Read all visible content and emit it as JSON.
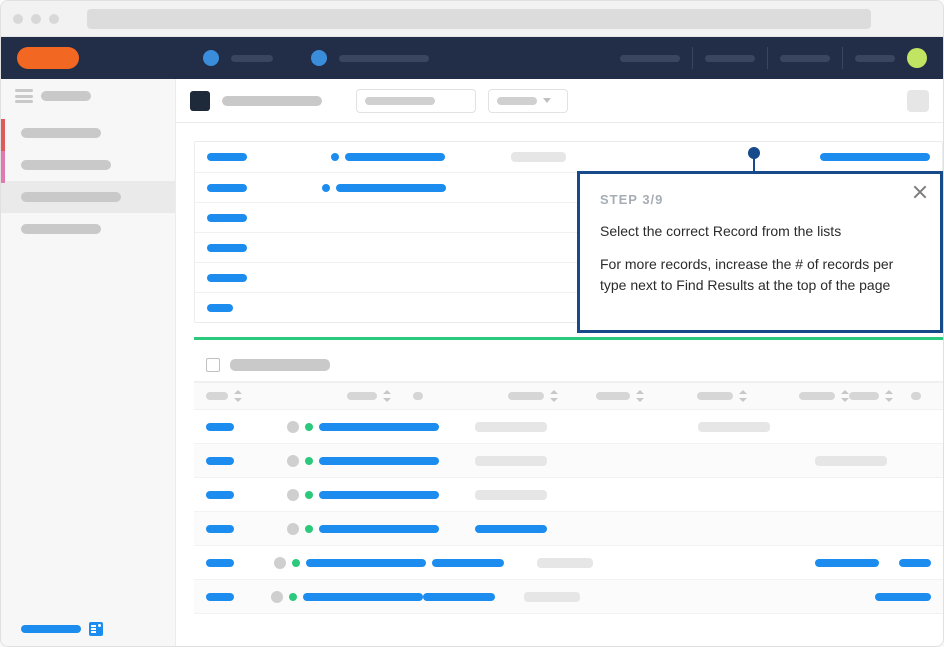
{
  "tour": {
    "step_label": "STEP 3/9",
    "line1": "Select the correct Record from the lists",
    "line2": "For more records, increase the # of records per type next to Find Results at the top of the page"
  },
  "colors": {
    "primary_blue": "#1c8def",
    "accent_orange": "#f26722",
    "success_green": "#2bc97b",
    "popover_border": "#164a8a"
  }
}
